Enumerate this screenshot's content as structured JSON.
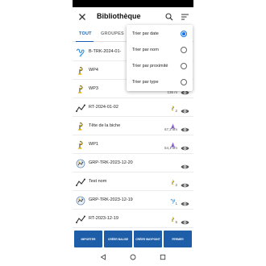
{
  "appbar": {
    "title": "Bibliothèque",
    "close_icon": "close-icon",
    "search_icon": "search-icon",
    "sort_icon": "sort-icon"
  },
  "tabs": [
    {
      "label": "TOUT",
      "active": true
    },
    {
      "label": "GROUPES",
      "active": false
    }
  ],
  "sort_menu": {
    "options": [
      {
        "label": "Trier par date",
        "selected": true
      },
      {
        "label": "Trier par nom",
        "selected": false
      },
      {
        "label": "Trier par proximité",
        "selected": false
      },
      {
        "label": "Trier par type",
        "selected": false
      }
    ]
  },
  "items": [
    {
      "name": "B-TRK-2024-01-",
      "type_icon": "beacon-track-icon",
      "meta_icon": "",
      "meta_text": "",
      "show_eye": false
    },
    {
      "name": "WP4",
      "type_icon": "waypoint-icon",
      "meta_icon": "",
      "meta_text": "",
      "show_eye": false
    },
    {
      "name": "WP3",
      "type_icon": "waypoint-icon",
      "meta_icon": "",
      "meta_text": "136 m",
      "show_eye": true
    },
    {
      "name": "RT-2024-01-02",
      "type_icon": "route-icon",
      "meta_icon": "waypoint-icon",
      "meta_text": "2",
      "show_eye": true
    },
    {
      "name": "Tête de la biche",
      "type_icon": "waypoint-icon",
      "meta_icon": "direction-arrow-icon",
      "meta_text": "67,2 km",
      "show_eye": true
    },
    {
      "name": "WP1",
      "type_icon": "waypoint-icon",
      "meta_icon": "direction-arrow-icon",
      "meta_text": "54,1 km",
      "show_eye": true
    },
    {
      "name": "GRP-TRK-2023-12-20",
      "type_icon": "group-icon",
      "meta_icon": "",
      "meta_text": "",
      "show_eye": true
    },
    {
      "name": "Test nom",
      "type_icon": "route-icon",
      "meta_icon": "waypoint-icon",
      "meta_text": "2",
      "show_eye": true
    },
    {
      "name": "GRP-TRK-2023-12-19",
      "type_icon": "group-icon",
      "meta_icon": "beacon-track-icon",
      "meta_text": "1",
      "show_eye": true
    },
    {
      "name": "RT-2023-12-19",
      "type_icon": "route-icon",
      "meta_icon": "waypoint-icon",
      "meta_text": "5",
      "show_eye": true
    }
  ],
  "actions": [
    {
      "label": "IMPORTER"
    },
    {
      "label": "CRÉER BALISE"
    },
    {
      "label": "CRÉER WAYPOINT"
    },
    {
      "label": "FERMER"
    }
  ],
  "navbar": {
    "back_icon": "back-triangle-icon",
    "home_icon": "home-circle-icon",
    "recents_icon": "recents-square-icon"
  },
  "colors": {
    "accent": "#1a5fb4",
    "button": "#1e5ea8",
    "waypoint": "#e0b400",
    "route": "#333333",
    "beacon": "#2b8fe0",
    "arrow": "#7a4fc9"
  }
}
